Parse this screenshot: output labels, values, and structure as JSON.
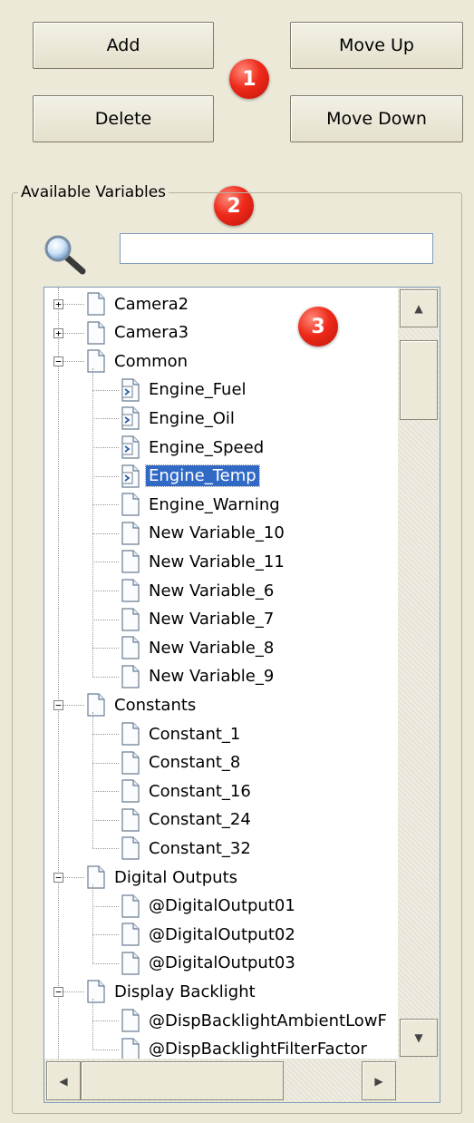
{
  "buttons": {
    "add": "Add",
    "move_up": "Move Up",
    "delete": "Delete",
    "move_down": "Move Down"
  },
  "badges": [
    "1",
    "2",
    "3"
  ],
  "group": {
    "title": "Available Variables"
  },
  "search": {
    "value": "",
    "placeholder": ""
  },
  "tree": {
    "rows": [
      {
        "label": "Camera2",
        "level": 0,
        "expander": "+",
        "icon": "page-icon"
      },
      {
        "label": "Camera3",
        "level": 0,
        "expander": "+",
        "icon": "page-icon"
      },
      {
        "label": "Common",
        "level": 0,
        "expander": "-",
        "icon": "page-icon"
      },
      {
        "label": "Engine_Fuel",
        "level": 1,
        "icon": "shortcut-page-icon"
      },
      {
        "label": "Engine_Oil",
        "level": 1,
        "icon": "shortcut-page-icon"
      },
      {
        "label": "Engine_Speed",
        "level": 1,
        "icon": "shortcut-page-icon"
      },
      {
        "label": "Engine_Temp",
        "level": 1,
        "icon": "shortcut-page-icon",
        "selected": true
      },
      {
        "label": "Engine_Warning",
        "level": 1,
        "icon": "page-icon"
      },
      {
        "label": "New Variable_10",
        "level": 1,
        "icon": "page-icon"
      },
      {
        "label": "New Variable_11",
        "level": 1,
        "icon": "page-icon"
      },
      {
        "label": "New Variable_6",
        "level": 1,
        "icon": "page-icon"
      },
      {
        "label": "New Variable_7",
        "level": 1,
        "icon": "page-icon"
      },
      {
        "label": "New Variable_8",
        "level": 1,
        "icon": "page-icon"
      },
      {
        "label": "New Variable_9",
        "level": 1,
        "icon": "page-icon"
      },
      {
        "label": "Constants",
        "level": 0,
        "expander": "-",
        "icon": "page-icon"
      },
      {
        "label": "Constant_1",
        "level": 1,
        "icon": "page-icon"
      },
      {
        "label": "Constant_8",
        "level": 1,
        "icon": "page-icon"
      },
      {
        "label": "Constant_16",
        "level": 1,
        "icon": "page-icon"
      },
      {
        "label": "Constant_24",
        "level": 1,
        "icon": "page-icon"
      },
      {
        "label": "Constant_32",
        "level": 1,
        "icon": "page-icon"
      },
      {
        "label": "Digital Outputs",
        "level": 0,
        "expander": "-",
        "icon": "page-icon"
      },
      {
        "label": "@DigitalOutput01",
        "level": 1,
        "icon": "page-icon"
      },
      {
        "label": "@DigitalOutput02",
        "level": 1,
        "icon": "page-icon"
      },
      {
        "label": "@DigitalOutput03",
        "level": 1,
        "icon": "page-icon"
      },
      {
        "label": "Display Backlight",
        "level": 0,
        "expander": "-",
        "icon": "page-icon"
      },
      {
        "label": "@DispBacklightAmbientLowF",
        "level": 1,
        "icon": "page-icon"
      },
      {
        "label": "@DispBacklightFilterFactor",
        "level": 1,
        "icon": "page-icon"
      }
    ]
  },
  "colors": {
    "window_bg": "#ece9d8",
    "selection": "#316ac5",
    "badge_red": "#e8281a",
    "field_border": "#7f9db9"
  }
}
